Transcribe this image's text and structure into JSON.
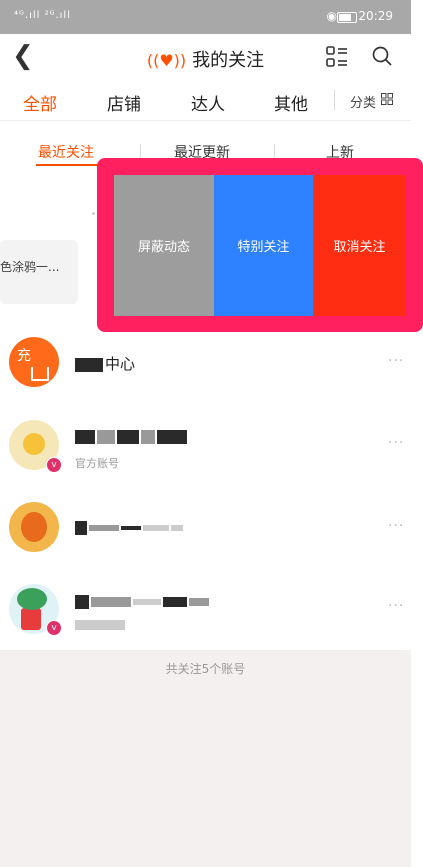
{
  "status_bar": {
    "time": "20:29",
    "signals": "⁴ᴳ.ıll ²ᴳ.ıll"
  },
  "nav": {
    "title": "我的关注"
  },
  "category_tabs": {
    "items": [
      {
        "label": "全部",
        "active": true
      },
      {
        "label": "店铺",
        "active": false
      },
      {
        "label": "达人",
        "active": false
      },
      {
        "label": "其他",
        "active": false
      }
    ],
    "classify_label": "分类"
  },
  "sub_tabs": {
    "items": [
      {
        "label": "最近关注",
        "active": true
      },
      {
        "label": "最近更新",
        "active": false
      },
      {
        "label": "上新",
        "active": false
      }
    ]
  },
  "partial_card": {
    "text": "色涂鸦一..."
  },
  "actions": {
    "block": "屏蔽动态",
    "special": "特别关注",
    "unfollow": "取消关注"
  },
  "follow_list": [
    {
      "name_visible": "中心",
      "avatar_text": "充",
      "subtitle": ""
    },
    {
      "name_visible": "",
      "avatar_text": "",
      "subtitle": "官方账号"
    },
    {
      "name_visible": "",
      "avatar_text": "",
      "subtitle": ""
    },
    {
      "name_visible": "",
      "avatar_text": "",
      "subtitle": ""
    }
  ],
  "row_more": "···",
  "footer": {
    "summary": "共关注5个账号"
  },
  "colors": {
    "accent": "#ff5000",
    "overlay_border": "#ff2060",
    "block": "#9d9d9d",
    "special": "#2f82ff",
    "unfollow": "#ff2e12"
  }
}
